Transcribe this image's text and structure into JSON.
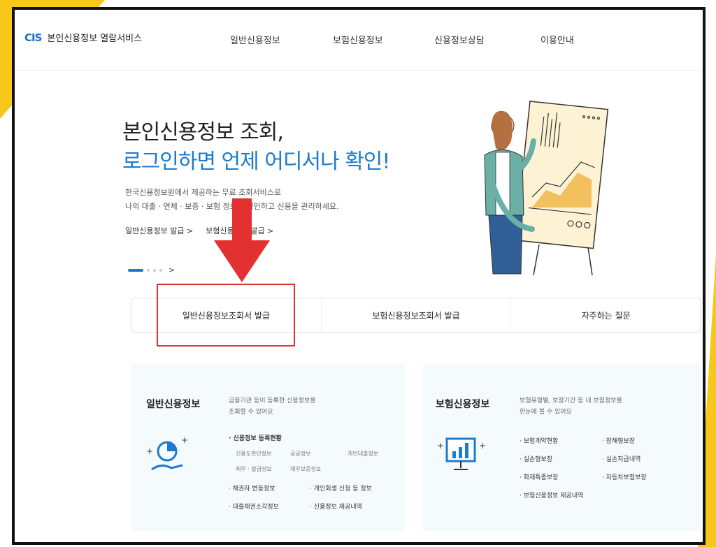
{
  "header": {
    "logo_mark": "CIS",
    "logo_text": "본인신용정보 열람서비스",
    "nav": [
      "일반신용정보",
      "보험신용정보",
      "신용정보상담",
      "이용안내"
    ]
  },
  "hero": {
    "title_line1": "본인신용정보 조회,",
    "title_line2": "로그인하면 언제 어디서나 확인!",
    "desc_line1": "한국신용정보원에서 제공하는 무료 조회서비스로",
    "desc_line2": "나의 대출 · 연체 · 보증 · 보험 정보를 확인하고 신용을 관리하세요.",
    "link1": "일반신용정보 발급 >",
    "link2": "보험신용정보 발급 >",
    "pager_next": ">"
  },
  "tabs": [
    "일반신용정보조회서 발급",
    "보험신용정보조회서 발급",
    "자주하는 질문"
  ],
  "card_general": {
    "title": "일반신용정보",
    "desc_line1": "금융기관 등이 등록한 신용정보를",
    "desc_line2": "조회할 수 있어요",
    "section": "· 신용정보 등록현황",
    "sub": [
      "신용도판단정보",
      "공공정보",
      "개인대출정보",
      "채무 · 발급정보",
      "채무보증정보"
    ],
    "items": [
      "· 채권자 변동정보",
      "· 개인회생 신청 등 정보",
      "· 대출채권소각정보",
      "· 신용정보 제공내역"
    ]
  },
  "card_insurance": {
    "title": "보험신용정보",
    "desc_line1": "보험유형별, 보장기간 등 내 보험정보를",
    "desc_line2": "한눈에 볼 수 있어요",
    "items": [
      "· 보험계약현황",
      "· 장해형보장",
      "· 실손형보장",
      "· 실손지급내역",
      "· 화재특종보장",
      "· 자동차보험보장",
      "· 보험신용정보 제공내역"
    ]
  },
  "colors": {
    "accent": "#1b7bd1",
    "highlight": "#e33030",
    "frame_corner": "#f7c719"
  }
}
